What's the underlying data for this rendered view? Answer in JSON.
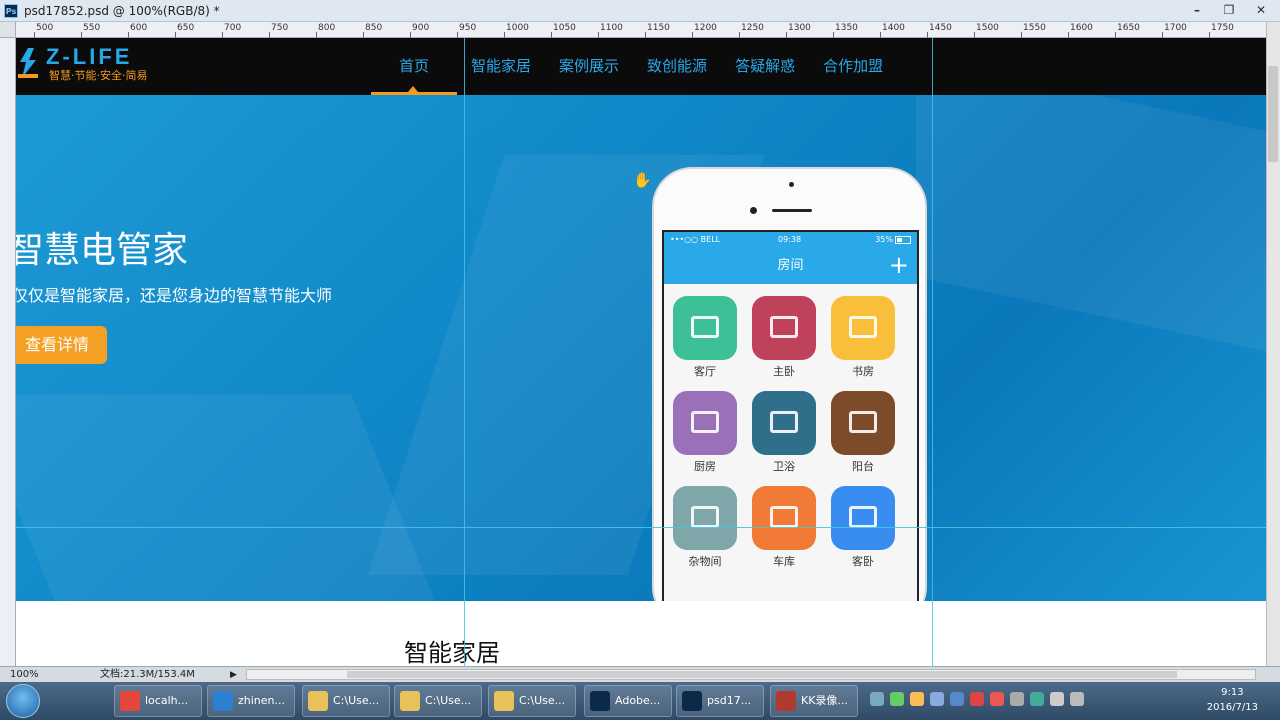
{
  "window": {
    "app_badge": "Ps",
    "title": "psd17852.psd @ 100%(RGB/8) *",
    "controls": [
      "–",
      "❐",
      "✕"
    ]
  },
  "ruler": {
    "ticks": [
      "500",
      "550",
      "600",
      "650",
      "700",
      "750",
      "800",
      "850",
      "900",
      "950",
      "1000",
      "1050",
      "1100",
      "1150",
      "1200",
      "1250",
      "1300",
      "1350",
      "1400",
      "1450",
      "1500",
      "1550",
      "1600",
      "1650",
      "1700",
      "1750"
    ]
  },
  "site": {
    "logo": {
      "title": "Z-LIFE",
      "subtitle": "智慧·节能·安全·简易"
    },
    "nav": [
      {
        "label": "首页",
        "active": true
      },
      {
        "label": "智能家居",
        "active": false
      },
      {
        "label": "案例展示",
        "active": false
      },
      {
        "label": "致创能源",
        "active": false
      },
      {
        "label": "答疑解惑",
        "active": false
      },
      {
        "label": "合作加盟",
        "active": false
      }
    ],
    "hero": {
      "title": "智慧电管家",
      "subtitle": "仅仅是智能家居，还是您身边的智慧节能大师",
      "button": "查看详情"
    },
    "phone": {
      "status": {
        "carrier": "•••○○ BELL",
        "time": "09:38",
        "battery": "35%"
      },
      "app_title": "房间",
      "add_icon": "+",
      "rooms": [
        {
          "label": "客厅",
          "color": "#3dbf97",
          "icon": "sofa-icon"
        },
        {
          "label": "主卧",
          "color": "#c0415a",
          "icon": "bed-icon"
        },
        {
          "label": "书房",
          "color": "#f9bf3b",
          "icon": "desk-icon"
        },
        {
          "label": "厨房",
          "color": "#9a70b8",
          "icon": "pot-icon"
        },
        {
          "label": "卫浴",
          "color": "#2f6f8a",
          "icon": "toilet-icon"
        },
        {
          "label": "阳台",
          "color": "#7b4b2a",
          "icon": "balcony-icon"
        },
        {
          "label": "杂物间",
          "color": "#7fa6a8",
          "icon": "box-icon"
        },
        {
          "label": "车库",
          "color": "#f07a36",
          "icon": "car-icon"
        },
        {
          "label": "客卧",
          "color": "#3a8df0",
          "icon": "guest-bed-icon"
        }
      ]
    },
    "section_title": "智能家居"
  },
  "statusbar": {
    "zoom": "100%",
    "doc": "文档:21.3M/153.4M"
  },
  "taskbar": {
    "items": [
      {
        "label": "localh...",
        "color": "#e5463a"
      },
      {
        "label": "zhinen...",
        "color": "#2d7fd3"
      },
      {
        "label": "C:\\Use...",
        "color": "#e8c15a"
      },
      {
        "label": "C:\\Use...",
        "color": "#e8c15a"
      },
      {
        "label": "C:\\Use...",
        "color": "#e8c15a"
      },
      {
        "label": "Adobe...",
        "color": "#0b2a4a"
      },
      {
        "label": "psd17...",
        "color": "#0b2a4a"
      },
      {
        "label": "KK录像...",
        "color": "#b03a2e"
      }
    ],
    "clock": {
      "time": "9:13",
      "date": "2016/7/13"
    }
  },
  "colors": {
    "accent": "#29a7e6",
    "orange": "#f39b1d",
    "guide": "#3ec6e6"
  }
}
